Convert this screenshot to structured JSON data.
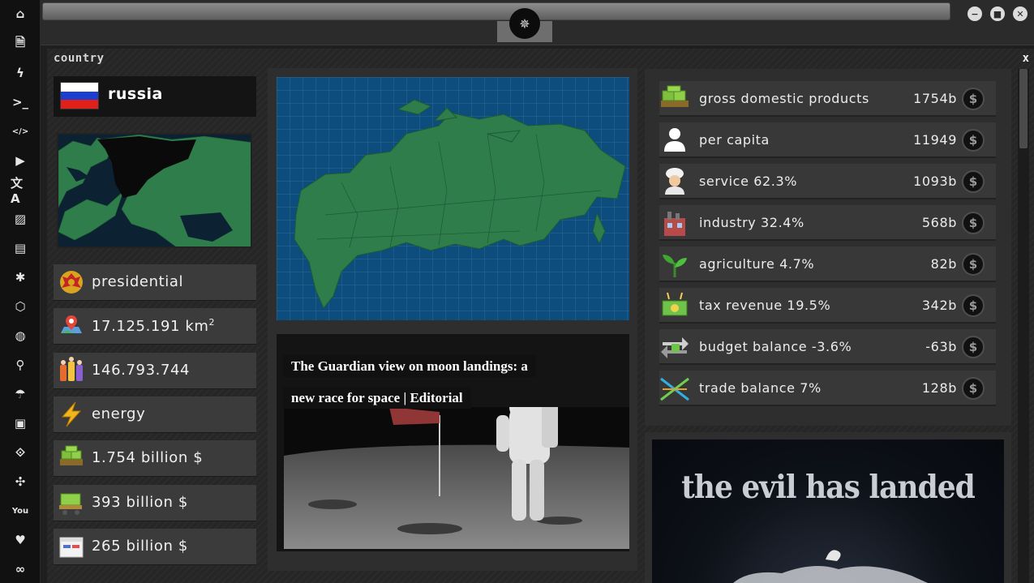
{
  "window": {
    "minimize_glyph": "−",
    "maximize_glyph": "■",
    "close_glyph": "✕",
    "logo_glyph": "✵"
  },
  "sidebar": {
    "items": [
      {
        "icon": "home-icon",
        "glyph": "⌂"
      },
      {
        "icon": "document-icon",
        "glyph": "🗎"
      },
      {
        "icon": "lightning-icon",
        "glyph": "ϟ"
      },
      {
        "icon": "terminal-icon",
        "glyph": ">_"
      },
      {
        "icon": "code-icon",
        "glyph": "</>"
      },
      {
        "icon": "play-icon",
        "glyph": "▶"
      },
      {
        "icon": "translate-icon",
        "glyph": "文A"
      },
      {
        "icon": "image-icon",
        "glyph": "▨"
      },
      {
        "icon": "newspaper-icon",
        "glyph": "▤"
      },
      {
        "icon": "asterisk-icon",
        "glyph": "✱"
      },
      {
        "icon": "hexagon-icon",
        "glyph": "⬡"
      },
      {
        "icon": "globe-icon",
        "glyph": "◍"
      },
      {
        "icon": "search-icon",
        "glyph": "⚲"
      },
      {
        "icon": "umbrella-icon",
        "glyph": "☂"
      },
      {
        "icon": "contact-card-icon",
        "glyph": "▣"
      },
      {
        "icon": "link-icon",
        "glyph": "⟐"
      },
      {
        "icon": "expand-icon",
        "glyph": "✣"
      },
      {
        "icon": "youtube-icon",
        "glyph": "You"
      },
      {
        "icon": "heart-icon",
        "glyph": "♥"
      },
      {
        "icon": "infinity-icon",
        "glyph": "∞"
      }
    ]
  },
  "panel": {
    "title": "country",
    "close_label": "x"
  },
  "country": {
    "name": "russia",
    "flag_colors": [
      "#ffffff",
      "#1c3fcf",
      "#e0201b"
    ],
    "government": "presidential",
    "area": "17.125.191 km",
    "area_unit_sup": "2",
    "population": "146.793.744",
    "sector": "energy",
    "gdp_text": "1.754 billion $",
    "exports_text": "393 billion $",
    "imports_text": "265 billion $"
  },
  "news": {
    "headline_line1": "The Guardian view on moon landings: a",
    "headline_line2": "new race for space | Editorial"
  },
  "stats": [
    {
      "icon": "money-stack-icon",
      "label": "gross domestic products",
      "value": "1754b"
    },
    {
      "icon": "person-icon",
      "label": "per capita",
      "value": "11949"
    },
    {
      "icon": "chef-icon",
      "label": "service 62.3%",
      "value": "1093b"
    },
    {
      "icon": "factory-icon",
      "label": "industry 32.4%",
      "value": "568b"
    },
    {
      "icon": "plant-icon",
      "label": "agriculture 4.7%",
      "value": "82b"
    },
    {
      "icon": "tax-icon",
      "label": "tax revenue 19.5%",
      "value": "342b"
    },
    {
      "icon": "exchange-icon",
      "label": "budget balance -3.6%",
      "value": "-63b"
    },
    {
      "icon": "trade-arrows-icon",
      "label": "trade balance 7%",
      "value": "128b"
    }
  ],
  "coin_glyph": "$",
  "promo": {
    "text": "the evil has landed"
  },
  "colors": {
    "map_land": "#2e7d4a",
    "map_sea": "#0d4d7e",
    "panel_bg": "#262626",
    "row_bg": "#3b3b3b"
  }
}
